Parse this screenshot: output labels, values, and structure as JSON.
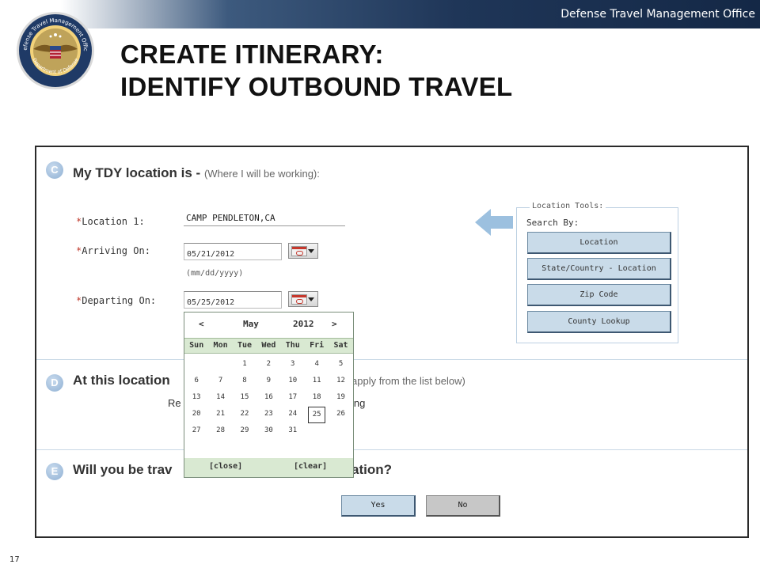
{
  "banner": {
    "org": "Defense Travel Management Office"
  },
  "seal": {
    "ring_text": "Defense Travel Management Office",
    "bottom_text": "Department of Defense"
  },
  "slide": {
    "title_line1": "CREATE ITINERARY:",
    "title_line2": "IDENTIFY OUTBOUND TRAVEL",
    "page_number": "17"
  },
  "section_c": {
    "badge": "C",
    "heading": "My TDY location is",
    "heading_dash": " - ",
    "subheading": "(Where I will be working):",
    "location_label": "Location 1:",
    "location_value": "CAMP PENDLETON,CA",
    "arriving_label": "Arriving On:",
    "arriving_value": "05/21/2012",
    "date_format_hint": "(mm/dd/yyyy)",
    "departing_label": "Departing On:",
    "departing_value": "05/25/2012",
    "required_marker": "*"
  },
  "location_tools": {
    "legend": "Location Tools:",
    "search_by": "Search By:",
    "buttons": [
      "Location",
      "State/Country - Location",
      "Zip Code",
      "County Lookup"
    ]
  },
  "section_d": {
    "badge": "D",
    "heading": "At this location",
    "hidden_text": "apply from the list below)",
    "line2_left": "Re",
    "line2_right": "ing"
  },
  "section_e": {
    "badge": "E",
    "heading_left": "Will you be trav",
    "heading_right": "ation?",
    "yes_label": "Yes",
    "no_label": "No"
  },
  "calendar": {
    "prev": "<",
    "month": "May",
    "year": "2012",
    "next": ">",
    "weekdays": [
      "Sun",
      "Mon",
      "Tue",
      "Wed",
      "Thu",
      "Fri",
      "Sat"
    ],
    "weeks": [
      [
        "",
        "",
        "1",
        "2",
        "3",
        "4",
        "5"
      ],
      [
        "6",
        "7",
        "8",
        "9",
        "10",
        "11",
        "12"
      ],
      [
        "13",
        "14",
        "15",
        "16",
        "17",
        "18",
        "19"
      ],
      [
        "20",
        "21",
        "22",
        "23",
        "24",
        "25",
        "26"
      ],
      [
        "27",
        "28",
        "29",
        "30",
        "31",
        "",
        ""
      ]
    ],
    "selected_day": "25",
    "close_label": "[close]",
    "clear_label": "[clear]"
  },
  "colors": {
    "banner_dark": "#142846",
    "button_blue": "#c9dbe9",
    "calendar_green": "#d9e9d2",
    "arrow_blue": "#9cc0df"
  }
}
